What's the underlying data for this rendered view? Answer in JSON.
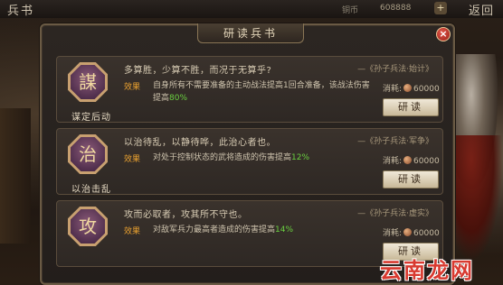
{
  "topbar": {
    "title": "兵书",
    "resource_label": "铜币",
    "resource_value": "608888",
    "plus": "+",
    "back": "返回"
  },
  "dialog": {
    "title": "研读兵书",
    "close": "×"
  },
  "cards": [
    {
      "name": "谋定后动",
      "icon": "scroll-sage-icon",
      "glyph": "謀",
      "quote": "多算胜，少算不胜，而况于无算乎?",
      "source": "—《孙子兵法·始计》",
      "effect_label": "效果",
      "effect_pre": "自身所有不需要准备的主动战法提高1回合准备，该战法伤害提高",
      "effect_value": "80%",
      "cost_label": "消耗:",
      "cost_value": "60000",
      "button": "研读"
    },
    {
      "name": "以治击乱",
      "icon": "crossed-blades-icon",
      "glyph": "治",
      "quote": "以治待乱，以静待哗，此治心者也。",
      "source": "—《孙子兵法·军争》",
      "effect_label": "效果",
      "effect_pre": "对处于控制状态的武将造成的伤害提高",
      "effect_value": "12%",
      "cost_label": "消耗:",
      "cost_value": "60000",
      "button": "研读"
    },
    {
      "name": "",
      "icon": "charging-warrior-icon",
      "glyph": "攻",
      "quote": "攻而必取者，攻其所不守也。",
      "source": "—《孙子兵法·虚实》",
      "effect_label": "效果",
      "effect_pre": "对敌军兵力最高者造成的伤害提高",
      "effect_value": "14%",
      "cost_label": "消耗:",
      "cost_value": "60000",
      "button": "研读"
    }
  ],
  "watermark": "云南龙网"
}
